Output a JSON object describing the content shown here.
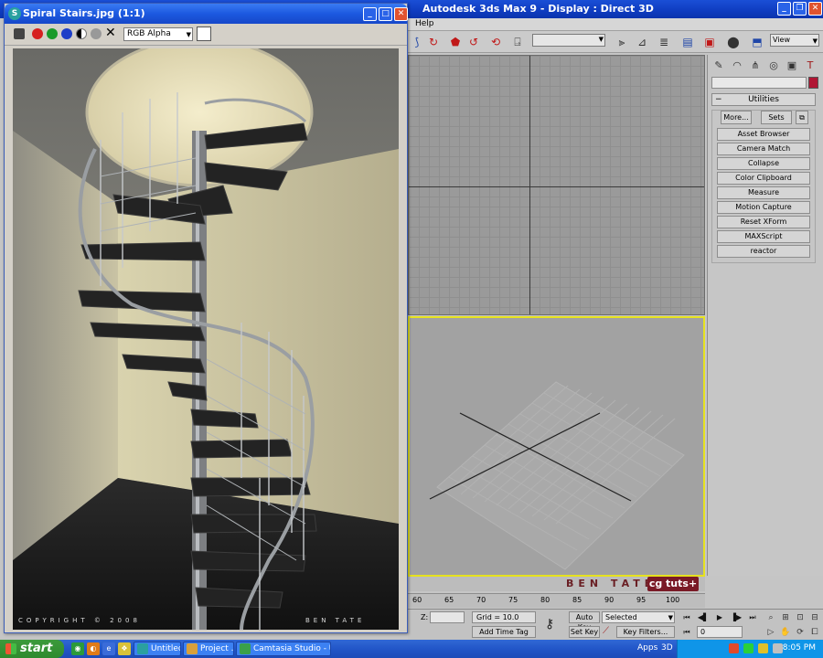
{
  "max_window": {
    "title": "Autodesk 3ds Max 9      - Display : Direct 3D",
    "menu": {
      "help": "Help"
    },
    "toolbar": {
      "view_label": "View"
    }
  },
  "command_panel": {
    "rollout_title": "Utilities",
    "more_label": "More...",
    "sets_label": "Sets",
    "utilities": [
      "Asset Browser",
      "Camera Match",
      "Collapse",
      "Color Clipboard",
      "Measure",
      "Motion Capture",
      "Reset XForm",
      "MAXScript",
      "reactor"
    ]
  },
  "watermark": {
    "author": "BEN TATE",
    "badge": "cg tuts+"
  },
  "timeline": {
    "ticks": [
      "60",
      "65",
      "70",
      "75",
      "80",
      "85",
      "90",
      "95",
      "100"
    ]
  },
  "status": {
    "z_label": "Z:",
    "grid": "Grid = 10.0",
    "add_time_tag": "Add Time Tag",
    "auto_key": "Auto Key",
    "set_key": "Set Key",
    "selected": "Selected",
    "key_filters": "Key Filters...",
    "frame": "0"
  },
  "viewer": {
    "title": "Spiral Stairs.jpg (1:1)",
    "channel": "RGB Alpha",
    "copyright": "COPYRIGHT © 2008",
    "signature": "BEN TATE"
  },
  "taskbar": {
    "start": "start",
    "tasks": [
      "Untitled",
      "Project ...",
      "Camtasia Studio - Unt..."
    ],
    "tray_3d": "3D",
    "tray_apps": "Apps",
    "clock": "8:05 PM"
  },
  "colors": {
    "title_blue": "#0f3cc0",
    "viewport_highlight": "#e6e21e",
    "badge": "#7a1a26",
    "swatch": "#b01634"
  }
}
